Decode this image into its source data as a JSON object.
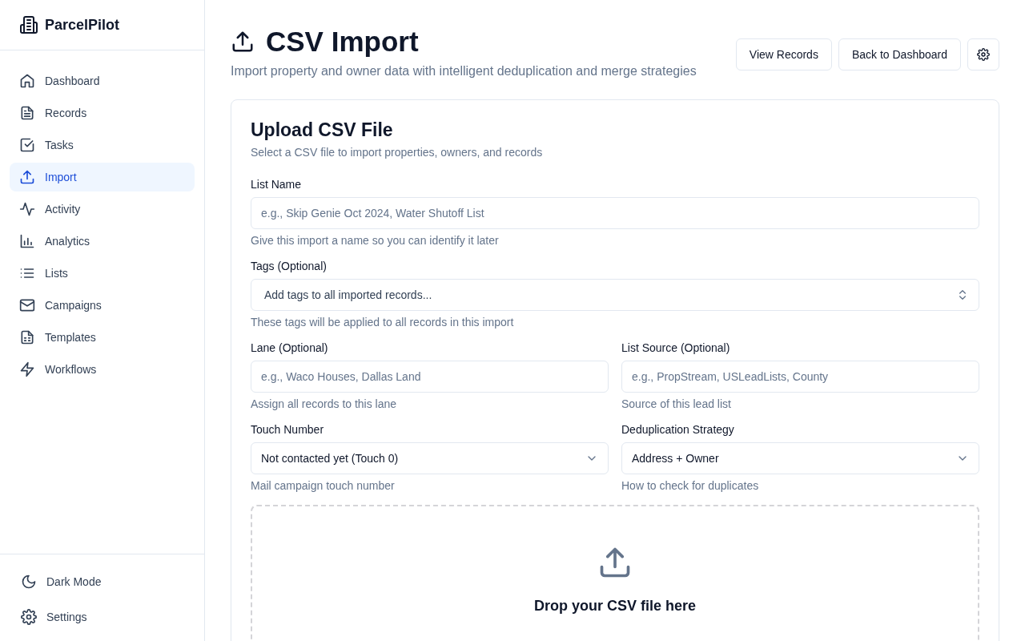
{
  "brand": "ParcelPilot",
  "nav": [
    {
      "label": "Dashboard",
      "selected": false
    },
    {
      "label": "Records",
      "selected": false
    },
    {
      "label": "Tasks",
      "selected": false
    },
    {
      "label": "Import",
      "selected": true
    },
    {
      "label": "Activity",
      "selected": false
    },
    {
      "label": "Analytics",
      "selected": false
    },
    {
      "label": "Lists",
      "selected": false
    },
    {
      "label": "Campaigns",
      "selected": false
    },
    {
      "label": "Templates",
      "selected": false
    },
    {
      "label": "Workflows",
      "selected": false
    }
  ],
  "sidebar_footer": [
    "Dark Mode",
    "Settings"
  ],
  "header": {
    "title": "CSV Import",
    "subtitle": "Import property and owner data with intelligent deduplication and merge strategies",
    "buttons": [
      "View Records",
      "Back to Dashboard"
    ]
  },
  "card": {
    "title": "Upload CSV File",
    "description": "Select a CSV file to import properties, owners, and records",
    "rows": [
      [
        {
          "kind": "text",
          "label": "List Name",
          "placeholder": "e.g., Skip Genie Oct 2024, Water Shutoff List",
          "help": "Give this import a name so you can identify it later"
        }
      ],
      [
        {
          "kind": "combobox",
          "label": "Tags (Optional)",
          "placeholder": "Add tags to all imported records...",
          "help": "These tags will be applied to all records in this import"
        }
      ],
      [
        {
          "kind": "text",
          "label": "Lane (Optional)",
          "placeholder": "e.g., Waco Houses, Dallas Land",
          "help": "Assign all records to this lane"
        },
        {
          "kind": "text",
          "label": "List Source (Optional)",
          "placeholder": "e.g., PropStream, USLeadLists, County",
          "help": "Source of this lead list"
        }
      ],
      [
        {
          "kind": "select",
          "label": "Touch Number",
          "value": "Not contacted yet (Touch 0)",
          "help": "Mail campaign touch number"
        },
        {
          "kind": "select",
          "label": "Deduplication Strategy",
          "value": "Address + Owner",
          "help": "How to check for duplicates"
        }
      ]
    ],
    "dropzone": {
      "title": "Drop your CSV file here"
    }
  }
}
